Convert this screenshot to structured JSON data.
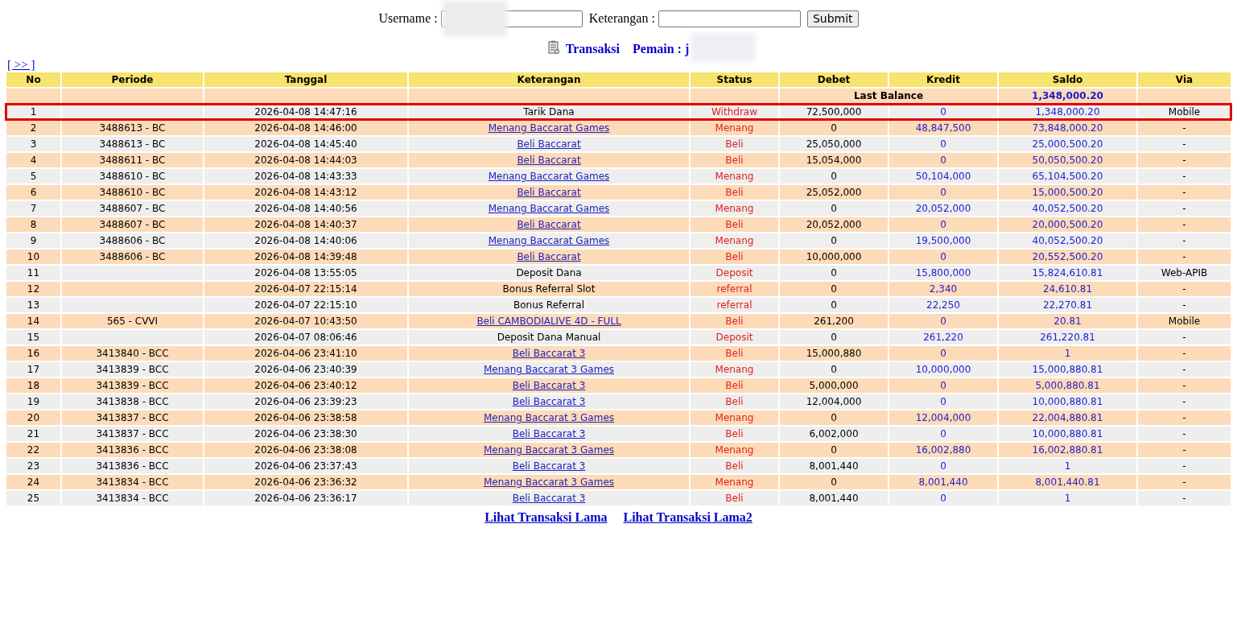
{
  "search_form": {
    "username_label": "Username :",
    "keterangan_label": "Keterangan :",
    "submit": "Submit",
    "username_redacted": true
  },
  "heading": {
    "title": "Transaksi",
    "player": "Pemain : j",
    "player_redacted": true
  },
  "nav_link": "[ >> ]",
  "table": {
    "columns": [
      "No",
      "Periode",
      "Tanggal",
      "Keterangan",
      "Status",
      "Debet",
      "Kredit",
      "Saldo",
      "Via"
    ],
    "last_balance": {
      "label": "Last Balance",
      "saldo": "1,348,000.20"
    },
    "rows": [
      {
        "no": "1",
        "periode": "",
        "tanggal": "2026-04-08 14:47:16",
        "keterangan": "Tarik Dana",
        "link": false,
        "status": "Withdraw",
        "debet": "72,500,000",
        "kredit": "0",
        "saldo": "1,348,000.20",
        "via": "Mobile",
        "outlined": true
      },
      {
        "no": "2",
        "periode": "3488613 - BC",
        "tanggal": "2026-04-08 14:46:00",
        "keterangan": "Menang Baccarat Games",
        "link": true,
        "status": "Menang",
        "debet": "0",
        "kredit": "48,847,500",
        "saldo": "73,848,000.20",
        "via": "-",
        "outlined": false
      },
      {
        "no": "3",
        "periode": "3488613 - BC",
        "tanggal": "2026-04-08 14:45:40",
        "keterangan": "Beli Baccarat",
        "link": true,
        "status": "Beli",
        "debet": "25,050,000",
        "kredit": "0",
        "saldo": "25,000,500.20",
        "via": "-",
        "outlined": false
      },
      {
        "no": "4",
        "periode": "3488611 - BC",
        "tanggal": "2026-04-08 14:44:03",
        "keterangan": "Beli Baccarat",
        "link": true,
        "status": "Beli",
        "debet": "15,054,000",
        "kredit": "0",
        "saldo": "50,050,500.20",
        "via": "-",
        "outlined": false
      },
      {
        "no": "5",
        "periode": "3488610 - BC",
        "tanggal": "2026-04-08 14:43:33",
        "keterangan": "Menang Baccarat Games",
        "link": true,
        "status": "Menang",
        "debet": "0",
        "kredit": "50,104,000",
        "saldo": "65,104,500.20",
        "via": "-",
        "outlined": false
      },
      {
        "no": "6",
        "periode": "3488610 - BC",
        "tanggal": "2026-04-08 14:43:12",
        "keterangan": "Beli Baccarat",
        "link": true,
        "status": "Beli",
        "debet": "25,052,000",
        "kredit": "0",
        "saldo": "15,000,500.20",
        "via": "-",
        "outlined": false
      },
      {
        "no": "7",
        "periode": "3488607 - BC",
        "tanggal": "2026-04-08 14:40:56",
        "keterangan": "Menang Baccarat Games",
        "link": true,
        "status": "Menang",
        "debet": "0",
        "kredit": "20,052,000",
        "saldo": "40,052,500.20",
        "via": "-",
        "outlined": false
      },
      {
        "no": "8",
        "periode": "3488607 - BC",
        "tanggal": "2026-04-08 14:40:37",
        "keterangan": "Beli Baccarat",
        "link": true,
        "status": "Beli",
        "debet": "20,052,000",
        "kredit": "0",
        "saldo": "20,000,500.20",
        "via": "-",
        "outlined": false
      },
      {
        "no": "9",
        "periode": "3488606 - BC",
        "tanggal": "2026-04-08 14:40:06",
        "keterangan": "Menang Baccarat Games",
        "link": true,
        "status": "Menang",
        "debet": "0",
        "kredit": "19,500,000",
        "saldo": "40,052,500.20",
        "via": "-",
        "outlined": false
      },
      {
        "no": "10",
        "periode": "3488606 - BC",
        "tanggal": "2026-04-08 14:39:48",
        "keterangan": "Beli Baccarat",
        "link": true,
        "status": "Beli",
        "debet": "10,000,000",
        "kredit": "0",
        "saldo": "20,552,500.20",
        "via": "-",
        "outlined": false
      },
      {
        "no": "11",
        "periode": "",
        "tanggal": "2026-04-08 13:55:05",
        "keterangan": "Deposit Dana",
        "link": false,
        "status": "Deposit",
        "debet": "0",
        "kredit": "15,800,000",
        "saldo": "15,824,610.81",
        "via": "Web-APIB",
        "outlined": false
      },
      {
        "no": "12",
        "periode": "",
        "tanggal": "2026-04-07 22:15:14",
        "keterangan": "Bonus Referral Slot",
        "link": false,
        "status": "referral",
        "debet": "0",
        "kredit": "2,340",
        "saldo": "24,610.81",
        "via": "-",
        "outlined": false
      },
      {
        "no": "13",
        "periode": "",
        "tanggal": "2026-04-07 22:15:10",
        "keterangan": "Bonus Referral",
        "link": false,
        "status": "referral",
        "debet": "0",
        "kredit": "22,250",
        "saldo": "22,270.81",
        "via": "-",
        "outlined": false
      },
      {
        "no": "14",
        "periode": "565 - CVVI",
        "tanggal": "2026-04-07 10:43:50",
        "keterangan": "Beli CAMBODIALIVE 4D - FULL",
        "link": true,
        "status": "Beli",
        "debet": "261,200",
        "kredit": "0",
        "saldo": "20.81",
        "via": "Mobile",
        "outlined": false
      },
      {
        "no": "15",
        "periode": "",
        "tanggal": "2026-04-07 08:06:46",
        "keterangan": "Deposit Dana Manual",
        "link": false,
        "status": "Deposit",
        "debet": "0",
        "kredit": "261,220",
        "saldo": "261,220.81",
        "via": "-",
        "outlined": false
      },
      {
        "no": "16",
        "periode": "3413840 - BCC",
        "tanggal": "2026-04-06 23:41:10",
        "keterangan": "Beli Baccarat 3",
        "link": true,
        "status": "Beli",
        "debet": "15,000,880",
        "kredit": "0",
        "saldo": "1",
        "via": "-",
        "outlined": false
      },
      {
        "no": "17",
        "periode": "3413839 - BCC",
        "tanggal": "2026-04-06 23:40:39",
        "keterangan": "Menang Baccarat 3 Games",
        "link": true,
        "status": "Menang",
        "debet": "0",
        "kredit": "10,000,000",
        "saldo": "15,000,880.81",
        "via": "-",
        "outlined": false
      },
      {
        "no": "18",
        "periode": "3413839 - BCC",
        "tanggal": "2026-04-06 23:40:12",
        "keterangan": "Beli Baccarat 3",
        "link": true,
        "status": "Beli",
        "debet": "5,000,000",
        "kredit": "0",
        "saldo": "5,000,880.81",
        "via": "-",
        "outlined": false
      },
      {
        "no": "19",
        "periode": "3413838 - BCC",
        "tanggal": "2026-04-06 23:39:23",
        "keterangan": "Beli Baccarat 3",
        "link": true,
        "status": "Beli",
        "debet": "12,004,000",
        "kredit": "0",
        "saldo": "10,000,880.81",
        "via": "-",
        "outlined": false
      },
      {
        "no": "20",
        "periode": "3413837 - BCC",
        "tanggal": "2026-04-06 23:38:58",
        "keterangan": "Menang Baccarat 3 Games",
        "link": true,
        "status": "Menang",
        "debet": "0",
        "kredit": "12,004,000",
        "saldo": "22,004,880.81",
        "via": "-",
        "outlined": false
      },
      {
        "no": "21",
        "periode": "3413837 - BCC",
        "tanggal": "2026-04-06 23:38:30",
        "keterangan": "Beli Baccarat 3",
        "link": true,
        "status": "Beli",
        "debet": "6,002,000",
        "kredit": "0",
        "saldo": "10,000,880.81",
        "via": "-",
        "outlined": false
      },
      {
        "no": "22",
        "periode": "3413836 - BCC",
        "tanggal": "2026-04-06 23:38:08",
        "keterangan": "Menang Baccarat 3 Games",
        "link": true,
        "status": "Menang",
        "debet": "0",
        "kredit": "16,002,880",
        "saldo": "16,002,880.81",
        "via": "-",
        "outlined": false
      },
      {
        "no": "23",
        "periode": "3413836 - BCC",
        "tanggal": "2026-04-06 23:37:43",
        "keterangan": "Beli Baccarat 3",
        "link": true,
        "status": "Beli",
        "debet": "8,001,440",
        "kredit": "0",
        "saldo": "1",
        "via": "-",
        "outlined": false
      },
      {
        "no": "24",
        "periode": "3413834 - BCC",
        "tanggal": "2026-04-06 23:36:32",
        "keterangan": "Menang Baccarat 3 Games",
        "link": true,
        "status": "Menang",
        "debet": "0",
        "kredit": "8,001,440",
        "saldo": "8,001,440.81",
        "via": "-",
        "outlined": false
      },
      {
        "no": "25",
        "periode": "3413834 - BCC",
        "tanggal": "2026-04-06 23:36:17",
        "keterangan": "Beli Baccarat 3",
        "link": true,
        "status": "Beli",
        "debet": "8,001,440",
        "kredit": "0",
        "saldo": "1",
        "via": "-",
        "outlined": false
      }
    ]
  },
  "footer_links": [
    "Lihat Transaksi Lama",
    "Lihat Transaksi Lama2"
  ]
}
